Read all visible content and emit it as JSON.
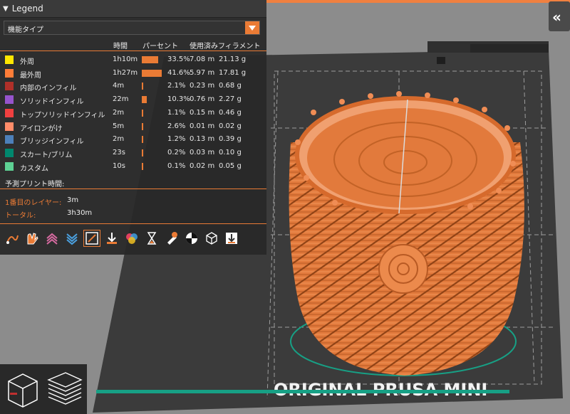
{
  "legend": {
    "title": "Legend",
    "view_type": "機能タイプ",
    "columns": {
      "time": "時間",
      "percent": "パーセント",
      "filament": "使用済みフィラメント"
    },
    "rows": [
      {
        "label": "外周",
        "color": "#FFE600",
        "time": "1h10m",
        "percent": "33.5%",
        "length": "7.08 m",
        "weight": "21.13 g",
        "fraction": 0.335
      },
      {
        "label": "最外周",
        "color": "#FF7D38",
        "time": "1h27m",
        "percent": "41.6%",
        "length": "5.97 m",
        "weight": "17.81 g",
        "fraction": 0.416
      },
      {
        "label": "内部のインフィル",
        "color": "#B03029",
        "time": "4m",
        "percent": "2.1%",
        "length": "0.23 m",
        "weight": "0.68 g",
        "fraction": 0.021
      },
      {
        "label": "ソリッドインフィル",
        "color": "#9654CC",
        "time": "22m",
        "percent": "10.3%",
        "length": "0.76 m",
        "weight": "2.27 g",
        "fraction": 0.103
      },
      {
        "label": "トップソリッドインフィル",
        "color": "#F04040",
        "time": "2m",
        "percent": "1.1%",
        "length": "0.15 m",
        "weight": "0.46 g",
        "fraction": 0.011
      },
      {
        "label": "アイロンがけ",
        "color": "#FF8C69",
        "time": "5m",
        "percent": "2.6%",
        "length": "0.01 m",
        "weight": "0.02 g",
        "fraction": 0.026
      },
      {
        "label": "ブリッジインフィル",
        "color": "#4D80BA",
        "time": "2m",
        "percent": "1.2%",
        "length": "0.13 m",
        "weight": "0.39 g",
        "fraction": 0.012
      },
      {
        "label": "スカート/ブリム",
        "color": "#00876E",
        "time": "23s",
        "percent": "0.2%",
        "length": "0.03 m",
        "weight": "0.10 g",
        "fraction": 0.002
      },
      {
        "label": "カスタム",
        "color": "#5ED194",
        "time": "10s",
        "percent": "0.1%",
        "length": "0.02 m",
        "weight": "0.05 g",
        "fraction": 0.001
      }
    ],
    "estimate_title": "予測プリント時間:",
    "first_layer_label": "1番目のレイヤー:",
    "first_layer_value": "3m",
    "total_label": "トータル:",
    "total_value": "3h30m"
  },
  "toolbar_icons": [
    "travel-icon",
    "wipe-icon",
    "retraction-icon",
    "deretraction-icon",
    "seams-icon",
    "tool-change-icon",
    "color-change-icon",
    "pause-icon",
    "custom-gcode-icon",
    "center-of-gravity-icon",
    "shells-icon",
    "tool-marker-icon"
  ],
  "scene": {
    "bed_label": "ORIGINAL PRUSA MINI",
    "accent_color": "#ea7b35",
    "model_color": "#e27a3c"
  }
}
